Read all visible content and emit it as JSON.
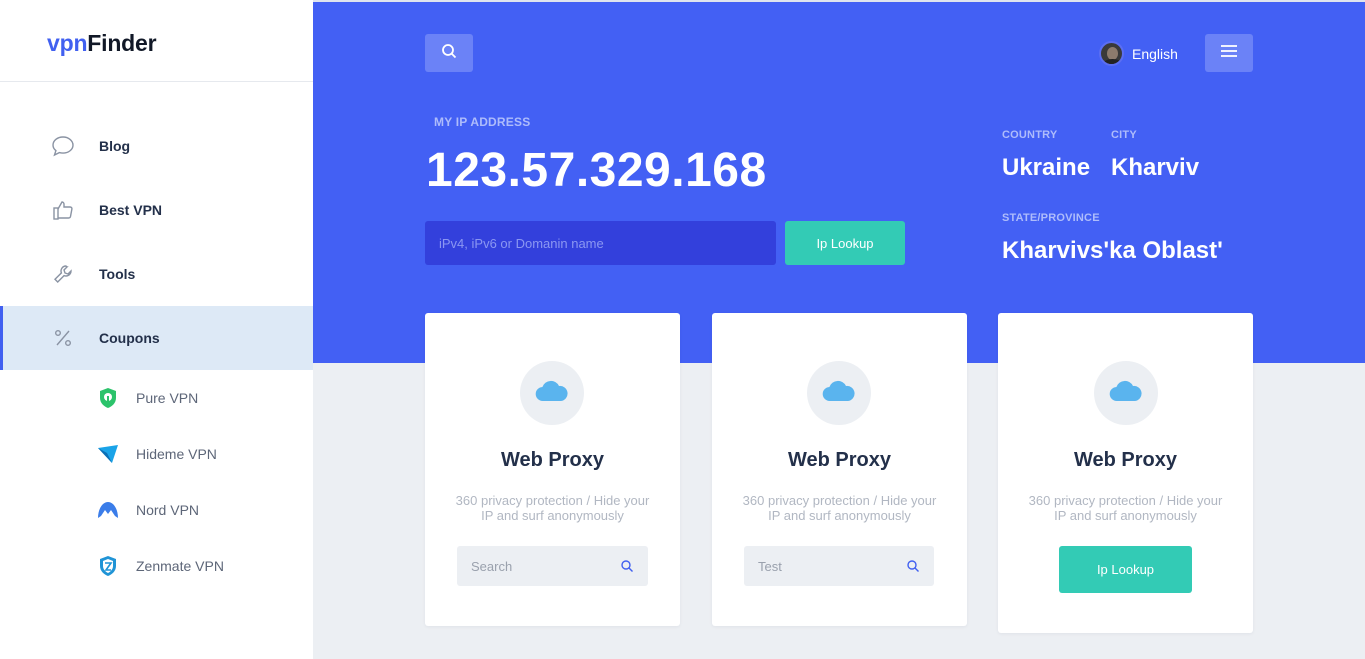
{
  "brand": {
    "part1": "vpn",
    "part2": "Finder",
    "accent_color": "#4160f0"
  },
  "sidebar": {
    "items": [
      {
        "label": "Blog",
        "icon": "chat-bubble-icon"
      },
      {
        "label": "Best VPN",
        "icon": "thumbs-up-icon"
      },
      {
        "label": "Tools",
        "icon": "wrench-icon"
      },
      {
        "label": "Coupons",
        "icon": "percent-icon",
        "active": true
      }
    ],
    "sub_items": [
      {
        "label": "Pure VPN",
        "icon": "purevpn-logo-icon"
      },
      {
        "label": "Hideme VPN",
        "icon": "hideme-logo-icon"
      },
      {
        "label": "Nord VPN",
        "icon": "nordvpn-logo-icon"
      },
      {
        "label": "Zenmate VPN",
        "icon": "zenmate-logo-icon"
      }
    ]
  },
  "header": {
    "search_icon": "search-icon",
    "menu_icon": "hamburger-menu-icon",
    "language": "English"
  },
  "hero": {
    "caption": "MY IP ADDRESS",
    "ip": "123.57.329.168",
    "input_placeholder": "iPv4, iPv6 or Domanin name",
    "lookup_label": "Ip Lookup",
    "country_caption": "COUNTRY",
    "country": "Ukraine",
    "city_caption": "CITY",
    "city": "Kharviv",
    "state_caption": "STATE/PROVINCE",
    "state": "Kharvivs'ka Oblast'",
    "bg_color": "#4360f4"
  },
  "cards": [
    {
      "title": "Web Proxy",
      "desc": "360 privacy protection / Hide your IP and surf anonymously",
      "input_placeholder": "Search",
      "icon": "cloud-icon"
    },
    {
      "title": "Web Proxy",
      "desc": "360 privacy protection / Hide your IP and surf anonymously",
      "input_placeholder": "Test",
      "icon": "cloud-icon"
    },
    {
      "title": "Web Proxy",
      "desc": "360 privacy protection / Hide your IP and surf anonymously",
      "button_label": "Ip Lookup",
      "icon": "cloud-icon"
    }
  ]
}
